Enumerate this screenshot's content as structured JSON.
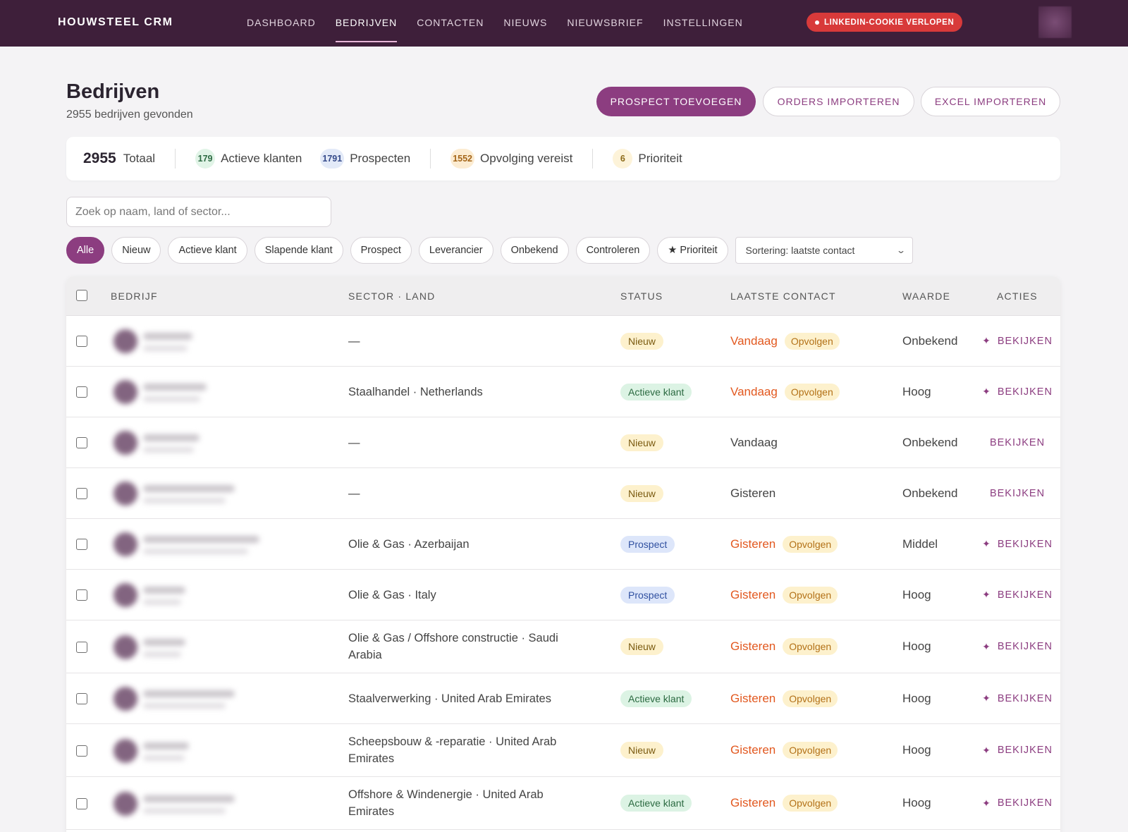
{
  "app": {
    "brand": "HOUWSTEEL CRM"
  },
  "nav": {
    "items": [
      {
        "label": "DASHBOARD",
        "active": false
      },
      {
        "label": "BEDRIJVEN",
        "active": true
      },
      {
        "label": "CONTACTEN",
        "active": false
      },
      {
        "label": "NIEUWS",
        "active": false
      },
      {
        "label": "NIEUWSBRIEF",
        "active": false
      },
      {
        "label": "INSTELLINGEN",
        "active": false
      }
    ],
    "alert": "LINKEDIN-COOKIE VERLOPEN"
  },
  "header": {
    "title": "Bedrijven",
    "subtitle": "2955 bedrijven gevonden",
    "buttons": {
      "primary": "PROSPECT TOEVOEGEN",
      "orders": "ORDERS IMPORTEREN",
      "excel": "EXCEL IMPORTEREN"
    }
  },
  "stats": {
    "total": {
      "value": "2955",
      "label": "Totaal"
    },
    "active": {
      "value": "179",
      "label": "Actieve klanten"
    },
    "prospects": {
      "value": "1791",
      "label": "Prospecten"
    },
    "followup": {
      "value": "1552",
      "label": "Opvolging vereist"
    },
    "priority": {
      "value": "6",
      "label": "Prioriteit"
    }
  },
  "search": {
    "placeholder": "Zoek op naam, land of sector..."
  },
  "filters": {
    "chips": [
      "Alle",
      "Nieuw",
      "Actieve klant",
      "Slapende klant",
      "Prospect",
      "Leverancier",
      "Onbekend",
      "Controleren",
      "★ Prioriteit"
    ],
    "active_index": 0,
    "sort": "Sortering: laatste contact"
  },
  "table": {
    "columns": [
      "BEDRIJF",
      "SECTOR · LAND",
      "STATUS",
      "LAATSTE CONTACT",
      "WAARDE",
      "ACTIES"
    ],
    "action_label": "BEKIJKEN",
    "follow_label": "Opvolgen",
    "rows": [
      {
        "sector": "—",
        "status": "Nieuw",
        "contact": "Vandaag",
        "urgent": true,
        "value": "Onbekend"
      },
      {
        "sector": "Staalhandel · Netherlands",
        "status": "Actieve klant",
        "contact": "Vandaag",
        "urgent": true,
        "value": "Hoog"
      },
      {
        "sector": "—",
        "status": "Nieuw",
        "contact": "Vandaag",
        "urgent": false,
        "value": "Onbekend"
      },
      {
        "sector": "—",
        "status": "Nieuw",
        "contact": "Gisteren",
        "urgent": false,
        "value": "Onbekend"
      },
      {
        "sector": "Olie & Gas · Azerbaijan",
        "status": "Prospect",
        "contact": "Gisteren",
        "urgent": true,
        "value": "Middel"
      },
      {
        "sector": "Olie & Gas · Italy",
        "status": "Prospect",
        "contact": "Gisteren",
        "urgent": true,
        "value": "Hoog"
      },
      {
        "sector": "Olie & Gas / Offshore constructie · Saudi Arabia",
        "status": "Nieuw",
        "contact": "Gisteren",
        "urgent": true,
        "value": "Hoog"
      },
      {
        "sector": "Staalverwerking · United Arab Emirates",
        "status": "Actieve klant",
        "contact": "Gisteren",
        "urgent": true,
        "value": "Hoog"
      },
      {
        "sector": "Scheepsbouw & -reparatie · United Arab Emirates",
        "status": "Nieuw",
        "contact": "Gisteren",
        "urgent": true,
        "value": "Hoog"
      },
      {
        "sector": "Offshore & Windenergie · United Arab Emirates",
        "status": "Actieve klant",
        "contact": "Gisteren",
        "urgent": true,
        "value": "Hoog"
      }
    ]
  },
  "colors": {
    "topbar": "#3e1f3a",
    "accent": "#8c3d80",
    "alert": "#d83a3a",
    "urgent": "#e2581f"
  }
}
